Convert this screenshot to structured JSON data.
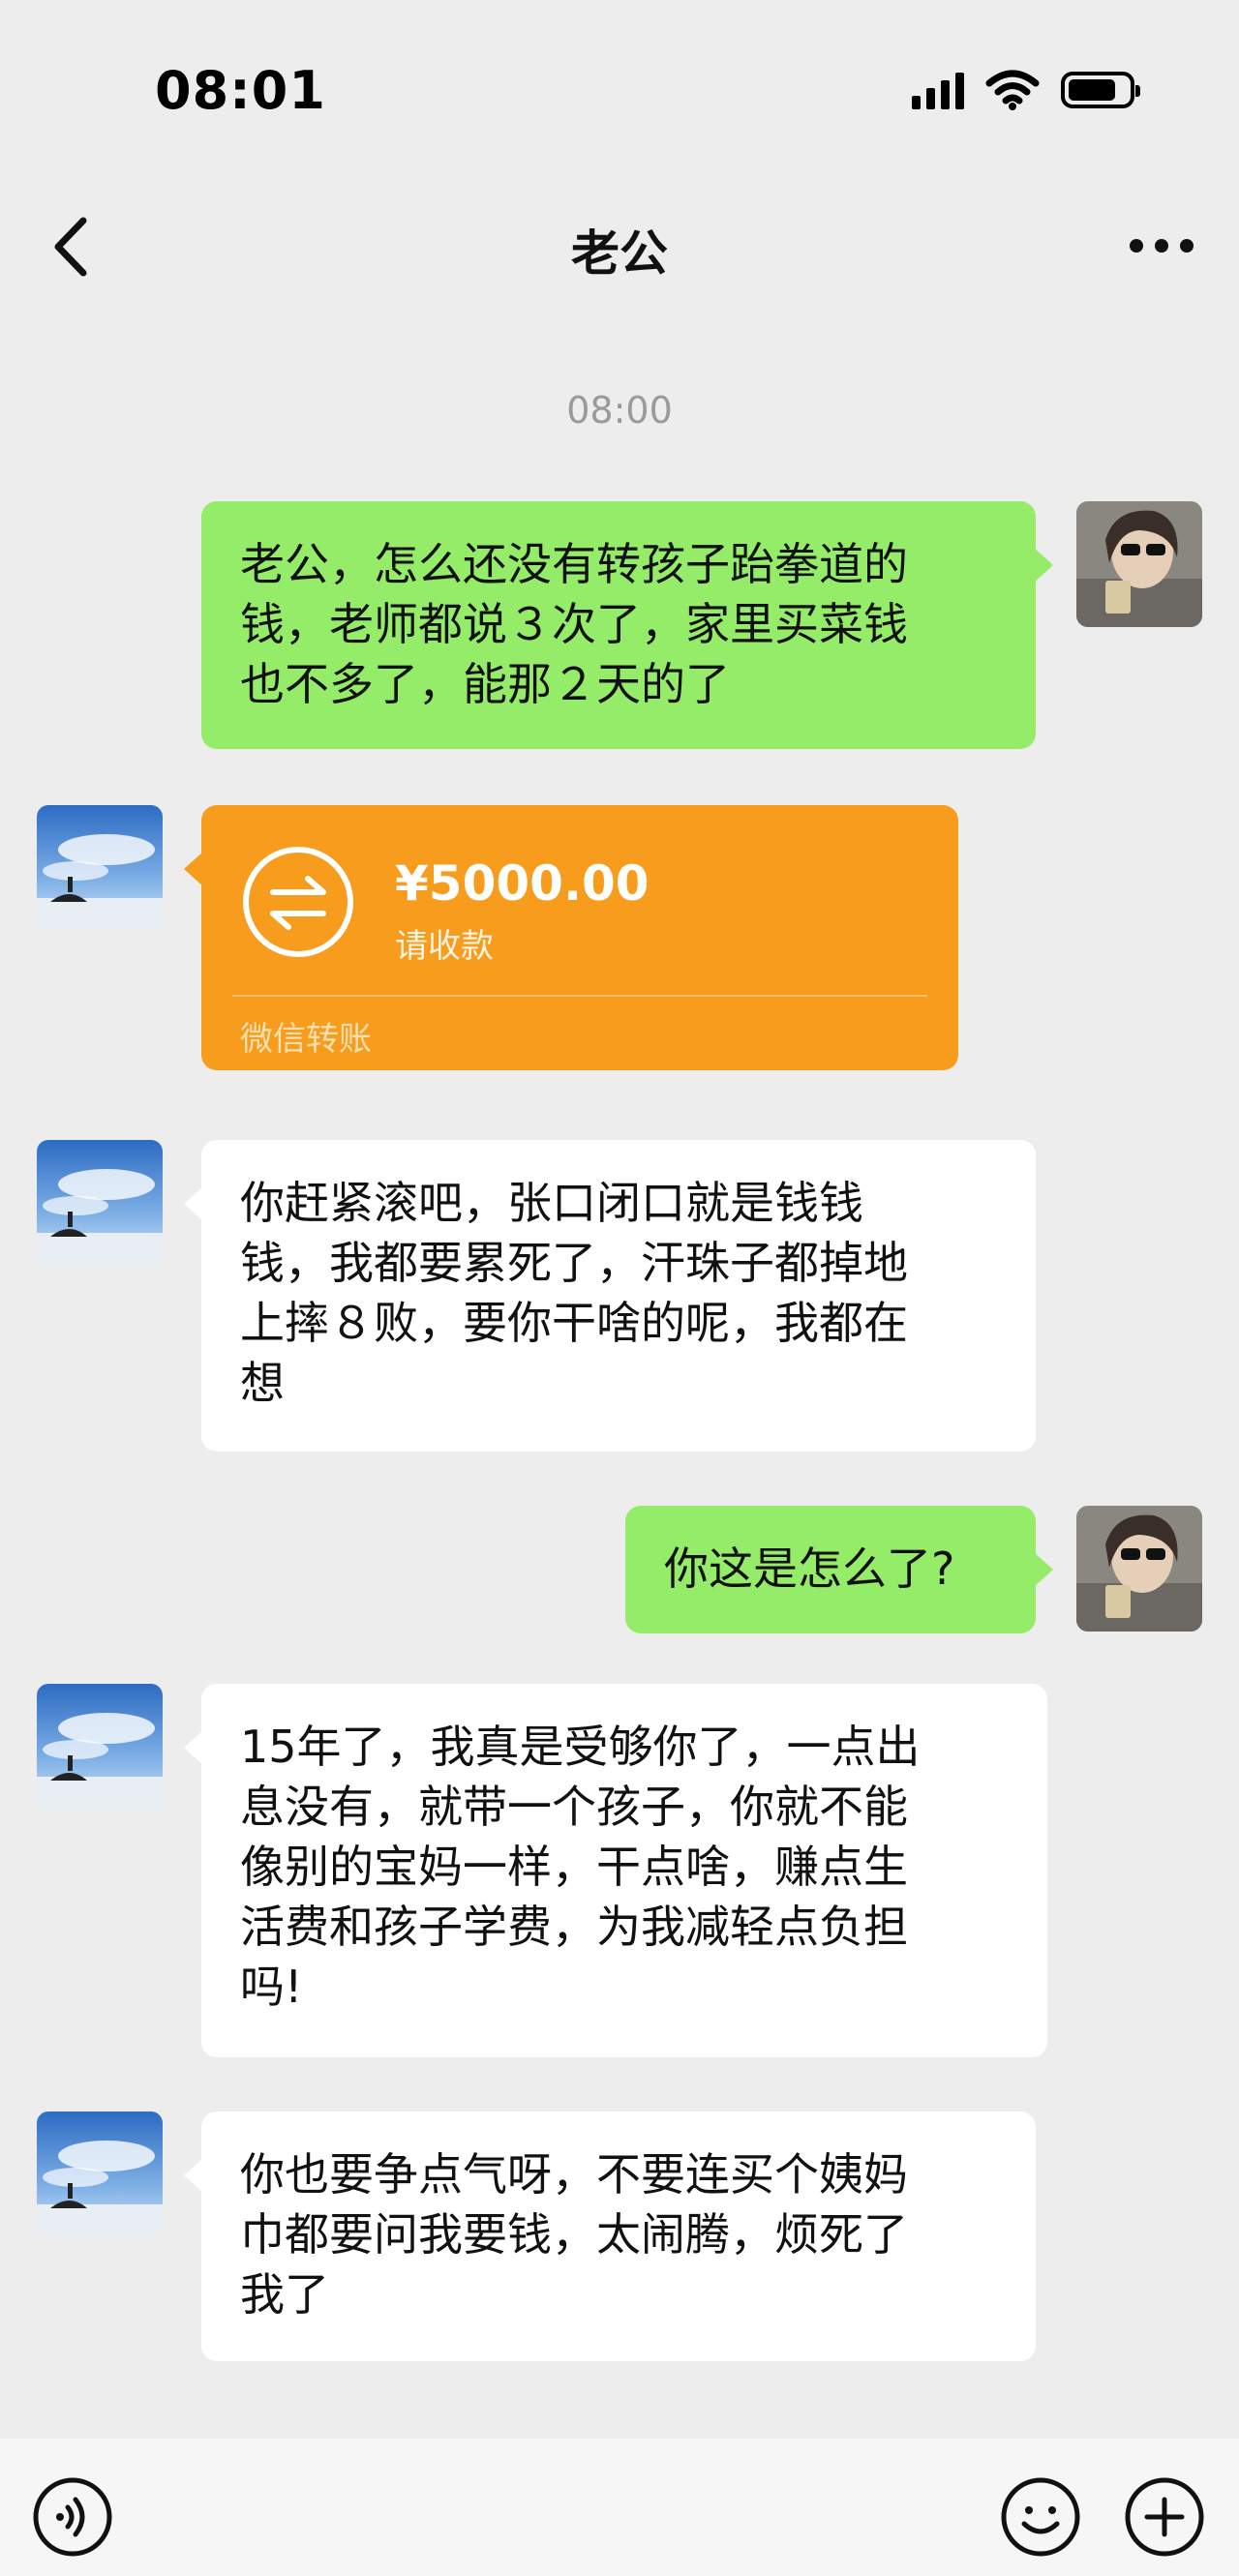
{
  "status_bar": {
    "time": "08:01",
    "icons": [
      "signal-icon",
      "wifi-icon",
      "battery-icon"
    ]
  },
  "nav": {
    "title": "老公",
    "back_icon": "chevron-left-icon",
    "more_icon": "more-dots-icon"
  },
  "chat": {
    "timestamp": "08:00",
    "messages": [
      {
        "side": "right",
        "type": "text",
        "lines": [
          "老公，怎么还没有转孩子跆拳道的",
          "钱，老师都说３次了，家里买菜钱",
          "也不多了，能那２天的了"
        ]
      },
      {
        "side": "left",
        "type": "transfer",
        "amount": "¥5000.00",
        "status": "请收款",
        "footer": "微信转账"
      },
      {
        "side": "left",
        "type": "text",
        "lines": [
          "你赶紧滚吧，张口闭口就是钱钱",
          "钱，我都要累死了，汗珠子都掉地",
          "上摔８败，要你干啥的呢，我都在",
          "想"
        ]
      },
      {
        "side": "right",
        "type": "text",
        "lines": [
          "你这是怎么了?"
        ]
      },
      {
        "side": "left",
        "type": "text",
        "lines": [
          "15年了，我真是受够你了，一点出",
          "息没有，就带一个孩子，你就不能",
          "像别的宝妈一样，干点啥，赚点生",
          "活费和孩子学费，为我减轻点负担",
          "吗!"
        ]
      },
      {
        "side": "left",
        "type": "text",
        "lines": [
          "你也要争点气呀，不要连买个姨妈",
          "巾都要问我要钱，太闹腾，烦死了",
          "我了"
        ]
      }
    ]
  },
  "input_bar": {
    "voice_icon": "voice-icon",
    "emoji_icon": "emoji-icon",
    "plus_icon": "plus-icon"
  },
  "colors": {
    "background": "#ededed",
    "self_bubble": "#95ec69",
    "other_bubble": "#ffffff",
    "transfer_card": "#f79c1c"
  }
}
